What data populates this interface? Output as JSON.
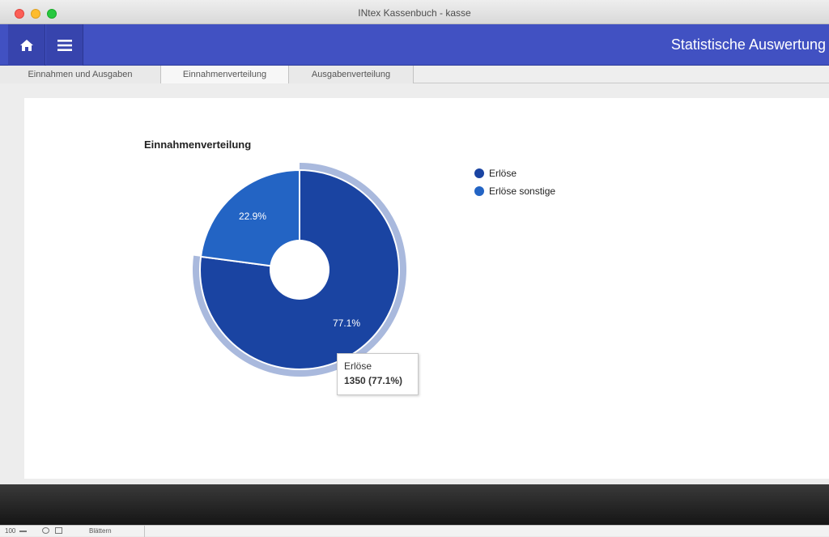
{
  "window": {
    "title": "INtex Kassenbuch - kasse"
  },
  "header": {
    "home_icon": "home-icon",
    "menu_icon": "hamburger-menu-icon",
    "title": "Statistische Auswertung"
  },
  "tabs": [
    {
      "label": "Einnahmen und Ausgaben",
      "active": false
    },
    {
      "label": "Einnahmenverteilung",
      "active": true
    },
    {
      "label": "Ausgabenverteilung",
      "active": false
    }
  ],
  "chart_data": {
    "type": "pie",
    "donut": true,
    "title": "Einnahmenverteilung",
    "categories": [
      "Erlöse",
      "Erlöse sonstige"
    ],
    "values": [
      1350,
      401
    ],
    "percent_labels": [
      "77.1%",
      "22.9%"
    ],
    "colors": [
      "#1a44a2",
      "#2364c4"
    ],
    "legend_position": "right",
    "highlighted_slice": "Erlöse"
  },
  "tooltip": {
    "name": "Erlöse",
    "value": "1350 (77.1%)"
  },
  "status": {
    "zoom": "100",
    "mode": "Blättern"
  }
}
